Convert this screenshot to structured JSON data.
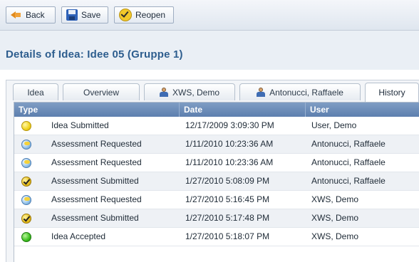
{
  "toolbar": {
    "back_label": "Back",
    "save_label": "Save",
    "reopen_label": "Reopen"
  },
  "header": {
    "title": "Details of Idea: Idee 05 (Gruppe 1)"
  },
  "tabs": [
    {
      "label": "Idea",
      "icon": ""
    },
    {
      "label": "Overview",
      "icon": ""
    },
    {
      "label": "XWS, Demo",
      "icon": "person-icon"
    },
    {
      "label": "Antonucci, Raffaele",
      "icon": "person-icon"
    },
    {
      "label": "History",
      "icon": "",
      "active": true
    }
  ],
  "grid": {
    "columns": [
      "Type",
      "Date",
      "User"
    ],
    "rows": [
      {
        "icon": "idea-submitted-icon",
        "type": "Idea Submitted",
        "date": "12/17/2009 3:09:30 PM",
        "user": "User, Demo"
      },
      {
        "icon": "assessment-requested-icon",
        "type": "Assessment Requested",
        "date": "1/11/2010 10:23:36 AM",
        "user": "Antonucci, Raffaele"
      },
      {
        "icon": "assessment-requested-icon",
        "type": "Assessment Requested",
        "date": "1/11/2010 10:23:36 AM",
        "user": "Antonucci, Raffaele"
      },
      {
        "icon": "assessment-submitted-icon",
        "type": "Assessment Submitted",
        "date": "1/27/2010 5:08:09 PM",
        "user": "Antonucci, Raffaele"
      },
      {
        "icon": "assessment-requested-icon",
        "type": "Assessment Requested",
        "date": "1/27/2010 5:16:45 PM",
        "user": "XWS, Demo"
      },
      {
        "icon": "assessment-submitted-icon",
        "type": "Assessment Submitted",
        "date": "1/27/2010 5:17:48 PM",
        "user": "XWS, Demo"
      },
      {
        "icon": "idea-accepted-icon",
        "type": "Idea Accepted",
        "date": "1/27/2010 5:18:07 PM",
        "user": "XWS, Demo"
      }
    ]
  },
  "colors": {
    "title": "#2d5d8e",
    "grid_header": "#6b8bb8",
    "row_alt": "#eef1f5"
  }
}
